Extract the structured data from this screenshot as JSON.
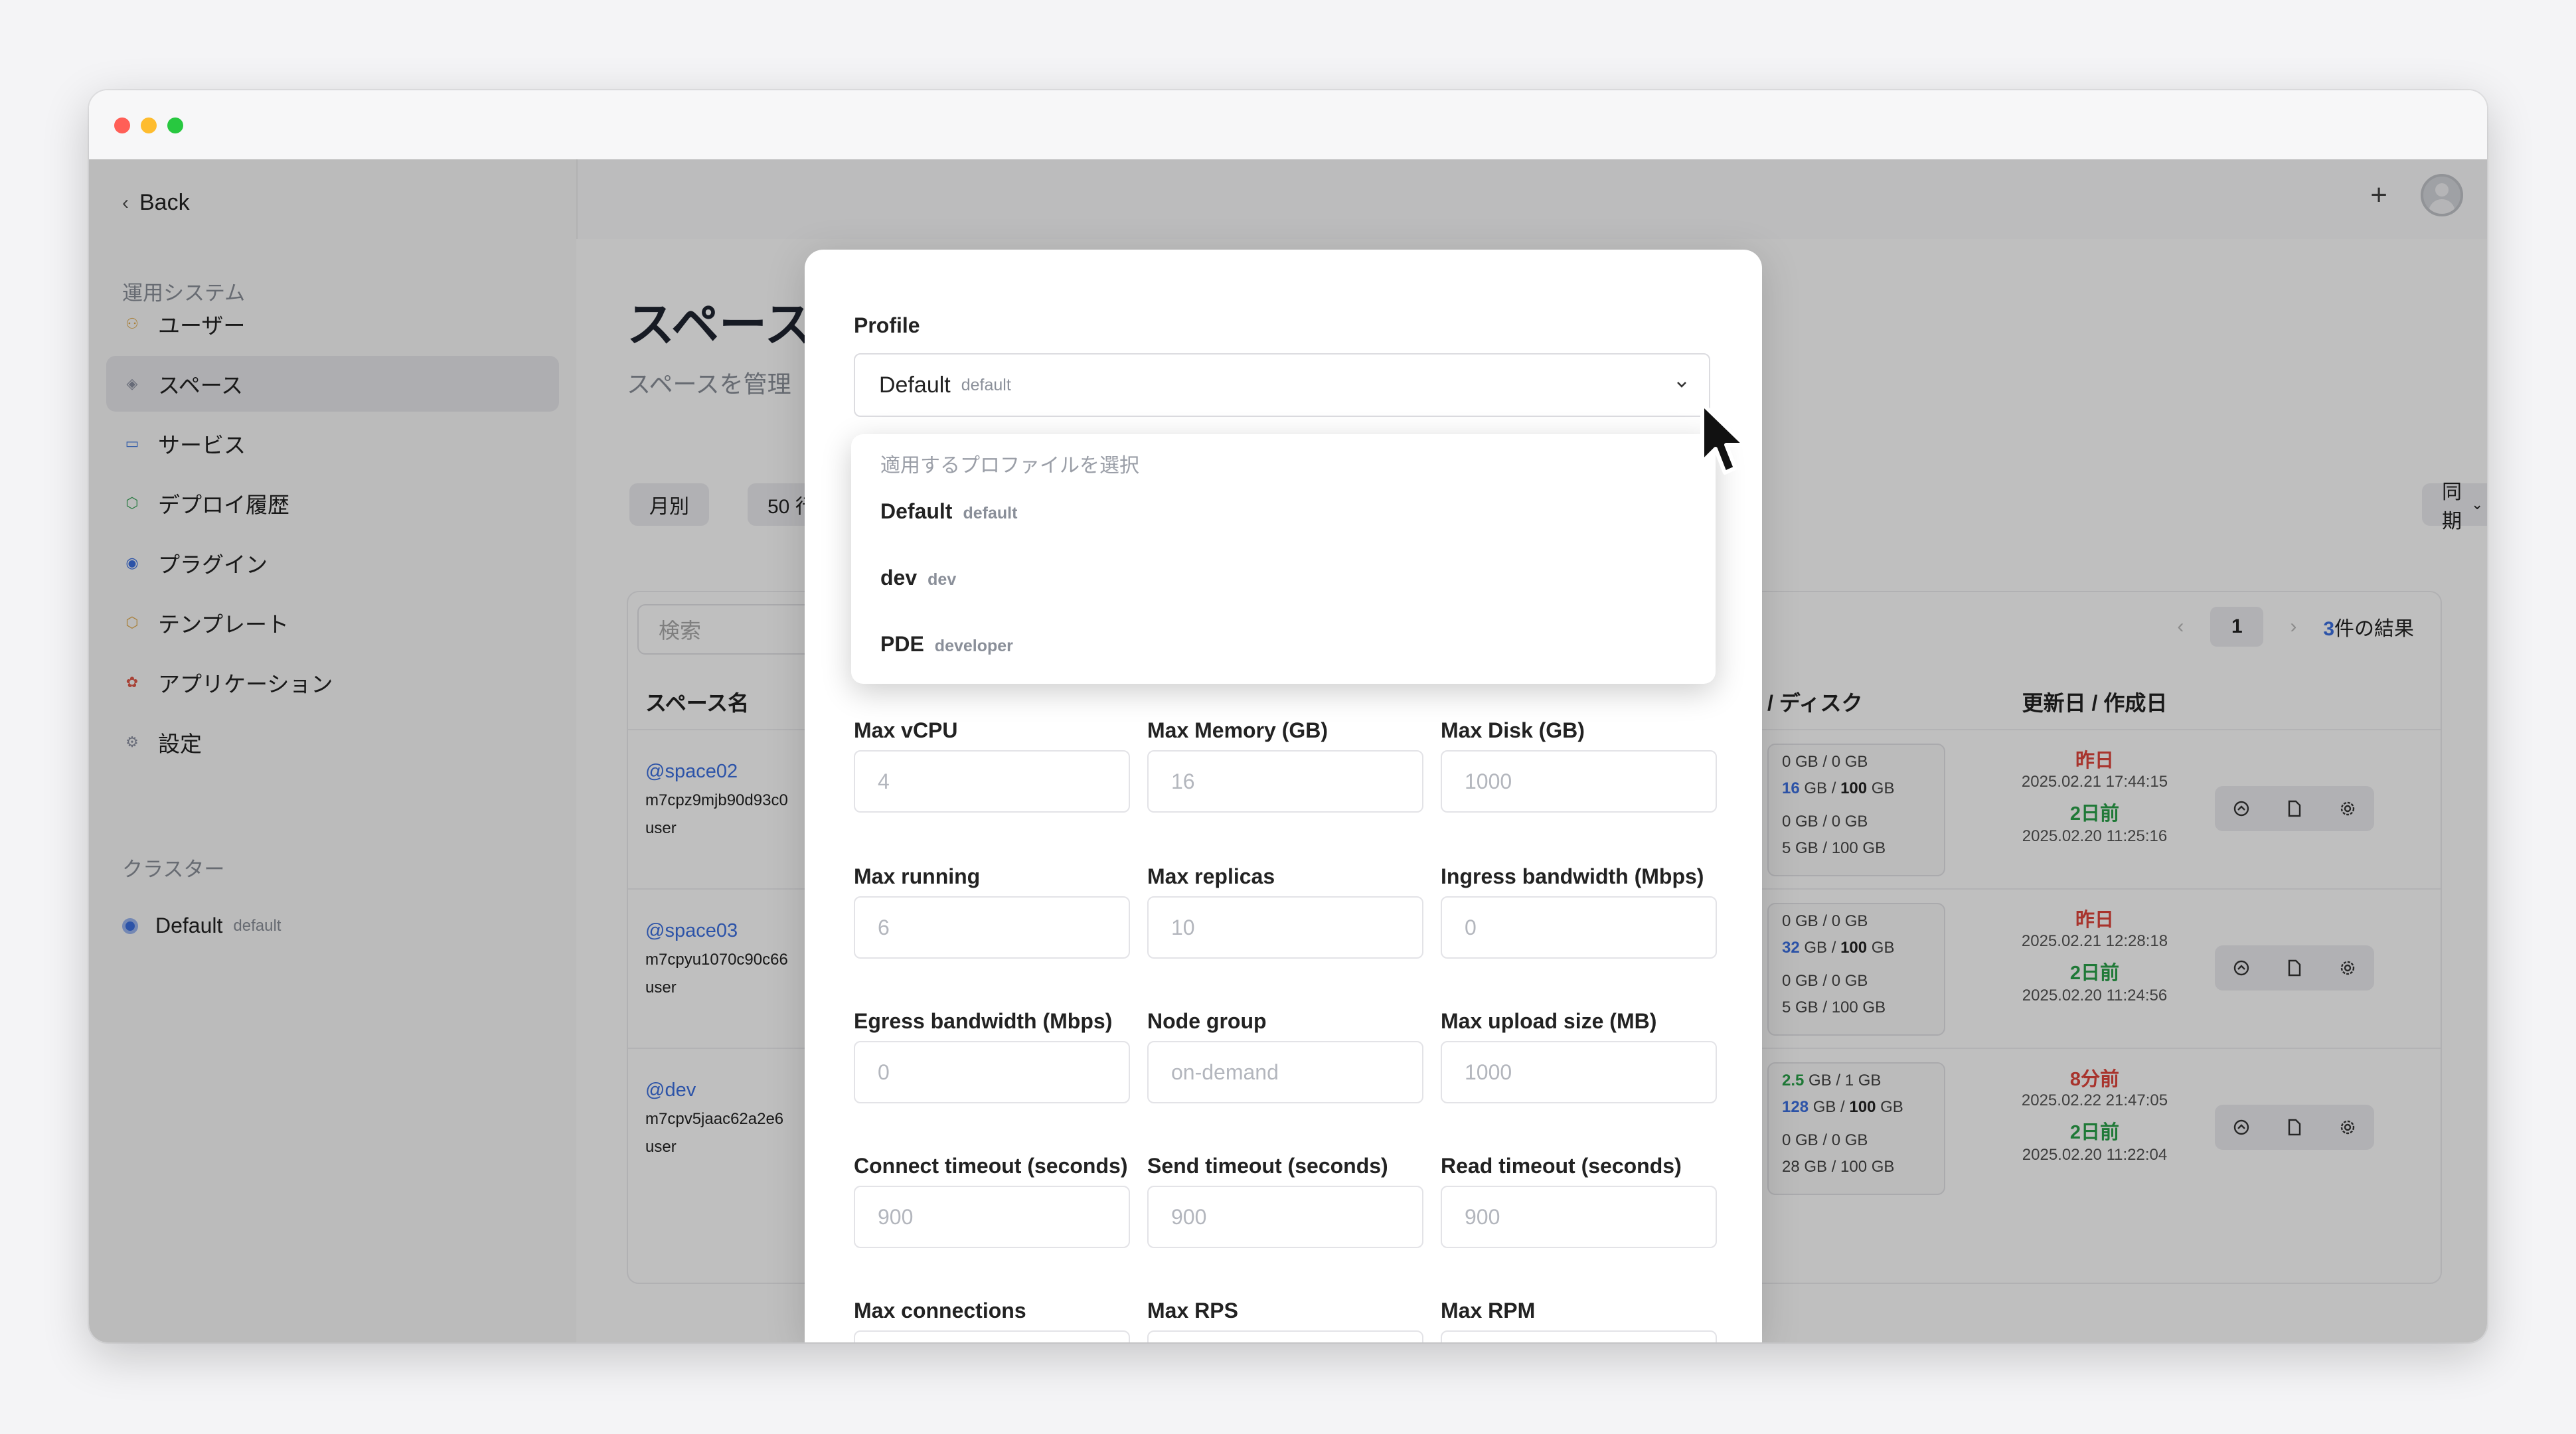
{
  "app": {
    "back_label": "Back"
  },
  "sidebar": {
    "section_system": "運用システム",
    "items": [
      {
        "label": "ユーザー",
        "icon": "users-icon"
      },
      {
        "label": "スペース",
        "icon": "layers-icon"
      },
      {
        "label": "サービス",
        "icon": "window-icon"
      },
      {
        "label": "デプロイ履歴",
        "icon": "box-icon"
      },
      {
        "label": "プラグイン",
        "icon": "plugin-icon"
      },
      {
        "label": "テンプレート",
        "icon": "template-icon"
      },
      {
        "label": "アプリケーション",
        "icon": "app-icon"
      },
      {
        "label": "設定",
        "icon": "settings-icon"
      }
    ],
    "section_cluster": "クラスター",
    "cluster": {
      "name": "Default",
      "tag": "default"
    }
  },
  "main": {
    "title": "スペース",
    "subtitle": "スペースを管理",
    "filter_month": "月別",
    "filter_rows": "50 行",
    "sync_label": "同期",
    "search_placeholder": "検索",
    "page_number": "1",
    "result_count": "3",
    "result_suffix": "件の結果",
    "col_name": "スペース名",
    "col_usage": "/ ディスク",
    "col_dates": "更新日 / 作成日",
    "rows": [
      {
        "name": "@space02",
        "id": "m7cpz9mjb90d93c0",
        "role": "user",
        "usage1": "0 GB / 0 GB",
        "usage2_hl": "16",
        "usage2_mid": " GB / ",
        "usage2_bk": "100",
        "usage2_end": " GB",
        "usage3": "0 GB / 0 GB",
        "usage4": "5 GB / 100 GB",
        "updated_rel": "昨日",
        "updated": "2025.02.21 17:44:15",
        "created_rel": "2日前",
        "created": "2025.02.20 11:25:16"
      },
      {
        "name": "@space03",
        "id": "m7cpyu1070c90c66",
        "role": "user",
        "usage1": "0 GB / 0 GB",
        "usage2_hl": "32",
        "usage2_mid": " GB / ",
        "usage2_bk": "100",
        "usage2_end": " GB",
        "usage3": "0 GB / 0 GB",
        "usage4": "5 GB / 100 GB",
        "updated_rel": "昨日",
        "updated": "2025.02.21 12:28:18",
        "created_rel": "2日前",
        "created": "2025.02.20 11:24:56"
      },
      {
        "name": "@dev",
        "id": "m7cpv5jaac62a2e6",
        "role": "user",
        "usage1_gr": "2.5",
        "usage1_rest": " GB / 1 GB",
        "usage2_hl": "128",
        "usage2_mid": " GB / ",
        "usage2_bk": "100",
        "usage2_end": " GB",
        "usage3": "0 GB / 0 GB",
        "usage4": "28 GB / 100 GB",
        "updated_rel": "8分前",
        "updated": "2025.02.22 21:47:05",
        "created_rel": "2日前",
        "created": "2025.02.20 11:22:04"
      }
    ]
  },
  "modal": {
    "profile_label": "Profile",
    "profile_value": "Default",
    "profile_tag": "default",
    "dropdown": {
      "hint": "適用するプロファイルを選択",
      "options": [
        {
          "label": "Default",
          "tag": "default"
        },
        {
          "label": "dev",
          "tag": "dev"
        },
        {
          "label": "PDE",
          "tag": "developer"
        }
      ]
    },
    "fields": [
      {
        "label": "Max vCPU",
        "placeholder": "4"
      },
      {
        "label": "Max Memory (GB)",
        "placeholder": "16"
      },
      {
        "label": "Max Disk (GB)",
        "placeholder": "1000"
      },
      {
        "label": "Max running",
        "placeholder": "6"
      },
      {
        "label": "Max replicas",
        "placeholder": "10"
      },
      {
        "label": "Ingress bandwidth (Mbps)",
        "placeholder": "0"
      },
      {
        "label": "Egress bandwidth (Mbps)",
        "placeholder": "0"
      },
      {
        "label": "Node group",
        "placeholder": "on-demand"
      },
      {
        "label": "Max upload size (MB)",
        "placeholder": "1000"
      },
      {
        "label": "Connect timeout (seconds)",
        "placeholder": "900"
      },
      {
        "label": "Send timeout (seconds)",
        "placeholder": "900"
      },
      {
        "label": "Read timeout (seconds)",
        "placeholder": "900"
      },
      {
        "label": "Max connections",
        "placeholder": ""
      },
      {
        "label": "Max RPS",
        "placeholder": ""
      },
      {
        "label": "Max RPM",
        "placeholder": ""
      }
    ]
  }
}
